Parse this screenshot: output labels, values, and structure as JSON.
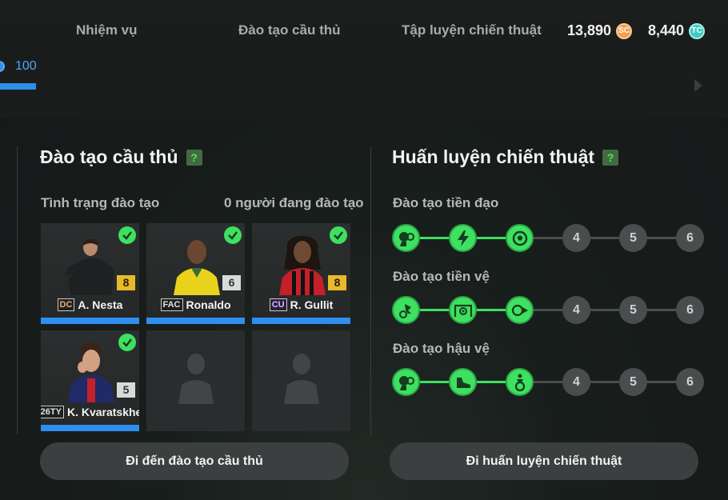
{
  "tabs": [
    "Nhiệm vụ",
    "Đào tạo cầu thủ",
    "Tập luyện chiến thuật"
  ],
  "currency": {
    "sc": {
      "amount": "13,890",
      "icon": "SC"
    },
    "tc": {
      "amount": "8,440",
      "icon": "TC"
    }
  },
  "progress": {
    "value": "100"
  },
  "player_training": {
    "title": "Đào tạo cầu thủ",
    "help": "?",
    "status_label": "Tình trạng đào tạo",
    "status_count": "0 người đang đào tạo",
    "cards": [
      {
        "name": "A. Nesta",
        "season": "DC",
        "level": "8",
        "level_type": "gold",
        "checked": true
      },
      {
        "name": "Ronaldo",
        "season": "FAC",
        "level": "6",
        "level_type": "silver",
        "checked": true
      },
      {
        "name": "R. Gullit",
        "season": "CU",
        "level": "8",
        "level_type": "gold",
        "checked": true
      },
      {
        "name": "K. Kvaratskhe",
        "season": "26TY",
        "level": "5",
        "level_type": "silver",
        "checked": true
      }
    ],
    "button": "Đi đến đào tạo cầu thủ"
  },
  "tactical_training": {
    "title": "Huấn luyện chiến thuật",
    "help": "?",
    "tracks": [
      {
        "title": "Đào tạo tiền đạo",
        "unlocked_icons": [
          "header-ball-icon",
          "lightning-icon",
          "ball-icon"
        ],
        "locked": [
          "4",
          "5",
          "6"
        ]
      },
      {
        "title": "Đào tạo tiền vệ",
        "unlocked_icons": [
          "kick-ball-icon",
          "goal-target-icon",
          "pass-ball-icon"
        ],
        "locked": [
          "4",
          "5",
          "6"
        ]
      },
      {
        "title": "Đào tạo hậu vệ",
        "unlocked_icons": [
          "header-ball-icon",
          "boot-icon",
          "player-ball-icon"
        ],
        "locked": [
          "4",
          "5",
          "6"
        ]
      }
    ],
    "button": "Đi huấn luyện chiến thuật"
  },
  "colors": {
    "accent_green": "#3ee060",
    "accent_blue": "#2e8ff0",
    "gold": "#e7b92c"
  }
}
